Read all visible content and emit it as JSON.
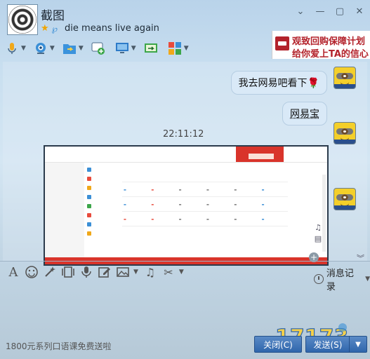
{
  "window": {
    "title": "截图",
    "status_message": "die means live  again",
    "controls": [
      "chevron-down",
      "minimize",
      "maximize",
      "close"
    ]
  },
  "ad": {
    "line1": "观致回购保障计划",
    "line2": "给你爱上TA的信心"
  },
  "toolbar": {
    "items": [
      "microphone-icon",
      "webcam-icon",
      "file-transfer-icon",
      "add-app-icon",
      "remote-desktop-icon",
      "share-screen-icon",
      "apps-icon"
    ]
  },
  "chat": {
    "messages": [
      {
        "text": "我去网易吧看下🌹",
        "side": "right"
      },
      {
        "text": "网易宝",
        "side": "right"
      }
    ],
    "timestamp": "22:11:12"
  },
  "input_toolbar": {
    "items": [
      "font-icon",
      "emoji-icon",
      "magic-icon",
      "gallery-icon",
      "voice-icon",
      "edit-icon",
      "image-icon",
      "music-icon",
      "scissors-icon"
    ],
    "history_label": "消息记录"
  },
  "footer": {
    "promo": "1800元系列口语课免费送啦",
    "close_label": "关闭(C)",
    "send_label": "发送(S)"
  },
  "watermark": {
    "text": "17173"
  },
  "colors": {
    "accent": "#2f66ac",
    "bubble": "#d9e9f7",
    "ad_red": "#b3222b"
  }
}
